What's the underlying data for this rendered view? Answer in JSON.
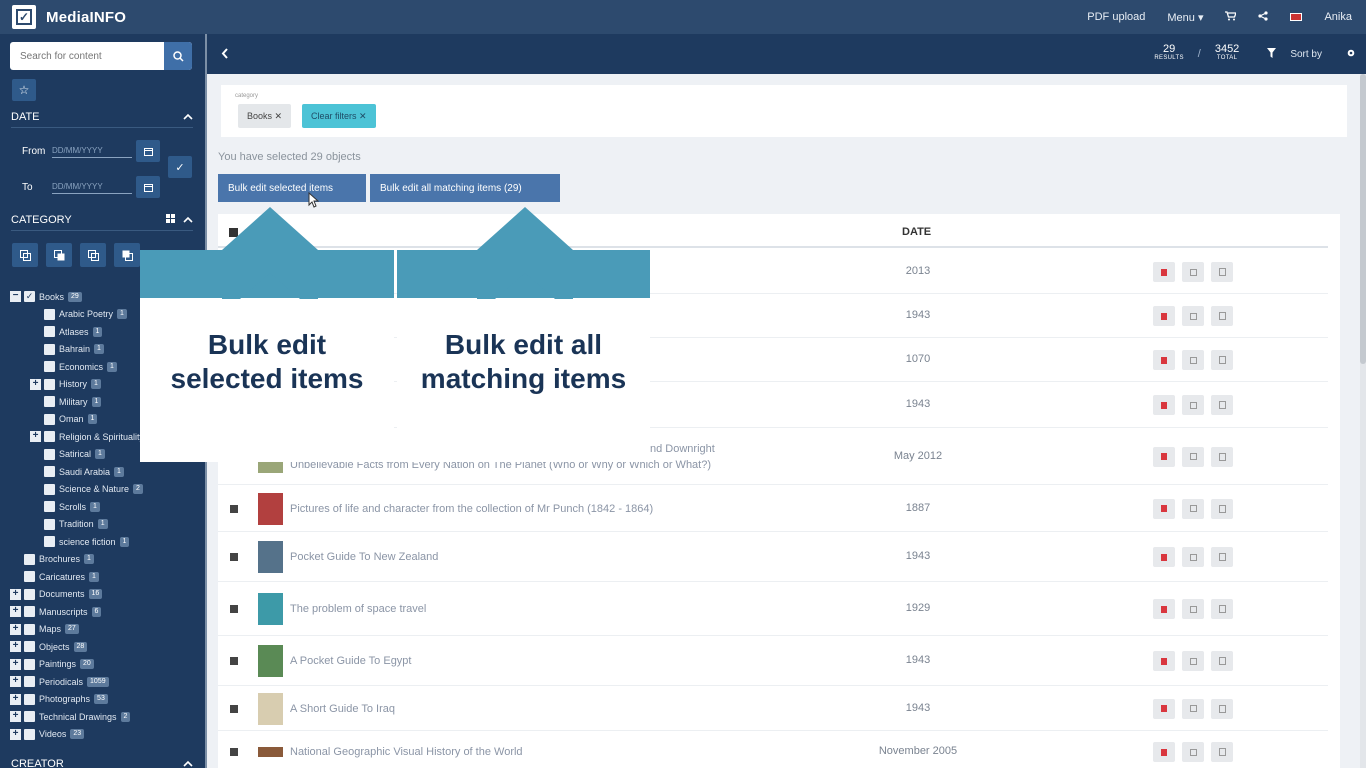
{
  "app": {
    "name": "MediaINFO"
  },
  "topnav": {
    "pdf_upload": "PDF upload",
    "menu": "Menu ▾",
    "cart_icon": "cart-icon",
    "share_icon": "share-icon",
    "user": "Anika"
  },
  "sidebar": {
    "search_placeholder": "Search for content",
    "date_section": "DATE",
    "from_label": "From",
    "to_label": "To",
    "date_placeholder": "DD/MM/YYYY",
    "category_section": "CATEGORY",
    "creator_section": "CREATOR",
    "tree": [
      {
        "label": "Books",
        "count": "29",
        "level": 0,
        "toggle": "−",
        "checked": true
      },
      {
        "label": "Arabic Poetry",
        "count": "1",
        "level": 1,
        "toggle": "",
        "checked": false
      },
      {
        "label": "Atlases",
        "count": "1",
        "level": 1,
        "toggle": "",
        "checked": false
      },
      {
        "label": "Bahrain",
        "count": "1",
        "level": 1,
        "toggle": "",
        "checked": false
      },
      {
        "label": "Economics",
        "count": "1",
        "level": 1,
        "toggle": "",
        "checked": false
      },
      {
        "label": "History",
        "count": "1",
        "level": 1,
        "toggle": "+",
        "checked": false
      },
      {
        "label": "Military",
        "count": "1",
        "level": 1,
        "toggle": "",
        "checked": false
      },
      {
        "label": "Oman",
        "count": "1",
        "level": 1,
        "toggle": "",
        "checked": false
      },
      {
        "label": "Religion & Spirituality",
        "count": "",
        "level": 1,
        "toggle": "+",
        "checked": false
      },
      {
        "label": "Satirical",
        "count": "1",
        "level": 1,
        "toggle": "",
        "checked": false
      },
      {
        "label": "Saudi Arabia",
        "count": "1",
        "level": 1,
        "toggle": "",
        "checked": false
      },
      {
        "label": "Science & Nature",
        "count": "2",
        "level": 1,
        "toggle": "",
        "checked": false
      },
      {
        "label": "Scrolls",
        "count": "1",
        "level": 1,
        "toggle": "",
        "checked": false
      },
      {
        "label": "Tradition",
        "count": "1",
        "level": 1,
        "toggle": "",
        "checked": false
      },
      {
        "label": "science fiction",
        "count": "1",
        "level": 1,
        "toggle": "",
        "checked": false
      },
      {
        "label": "Brochures",
        "count": "1",
        "level": 0,
        "toggle": "",
        "checked": false
      },
      {
        "label": "Caricatures",
        "count": "1",
        "level": 0,
        "toggle": "",
        "checked": false
      },
      {
        "label": "Documents",
        "count": "16",
        "level": 0,
        "toggle": "+",
        "checked": false
      },
      {
        "label": "Manuscripts",
        "count": "6",
        "level": 0,
        "toggle": "+",
        "checked": false
      },
      {
        "label": "Maps",
        "count": "27",
        "level": 0,
        "toggle": "+",
        "checked": false
      },
      {
        "label": "Objects",
        "count": "28",
        "level": 0,
        "toggle": "+",
        "checked": false
      },
      {
        "label": "Paintings",
        "count": "20",
        "level": 0,
        "toggle": "+",
        "checked": false
      },
      {
        "label": "Periodicals",
        "count": "1059",
        "level": 0,
        "toggle": "+",
        "checked": false
      },
      {
        "label": "Photographs",
        "count": "53",
        "level": 0,
        "toggle": "+",
        "checked": false
      },
      {
        "label": "Technical Drawings",
        "count": "2",
        "level": 0,
        "toggle": "+",
        "checked": false
      },
      {
        "label": "Videos",
        "count": "23",
        "level": 0,
        "toggle": "+",
        "checked": false
      }
    ]
  },
  "results": {
    "count": "29",
    "count_label": "RESULTS",
    "total": "3452",
    "total_label": "TOTAL",
    "sort_by": "Sort by"
  },
  "filters": {
    "label": "category",
    "books_chip": "Books ✕",
    "clear_chip": "Clear filters ✕"
  },
  "selection": {
    "text": "You have selected 29 objects",
    "bulk_selected": "Bulk edit selected items",
    "bulk_all": "Bulk edit all matching items (29)"
  },
  "table": {
    "date_header": "DATE",
    "rows": [
      {
        "title": "",
        "date": "2013",
        "thumb": ""
      },
      {
        "title": "",
        "date": "1943",
        "thumb": ""
      },
      {
        "title": "",
        "date": "1070",
        "thumb": ""
      },
      {
        "title": "",
        "date": "1943",
        "thumb": ""
      },
      {
        "title_line1": "nd Downright",
        "title_line2": "Unbelievable Facts from Every Nation on The Planet (Who or Why or Which or What?)",
        "date": "May 2012",
        "thumb": "#9aa678"
      },
      {
        "title": "Pictures of life and character from the collection of Mr Punch (1842 - 1864)",
        "date": "1887",
        "thumb": "#b2403f"
      },
      {
        "title": "Pocket Guide To New Zealand",
        "date": "1943",
        "thumb": "#55728a"
      },
      {
        "title": "The problem of space travel",
        "date": "1929",
        "thumb": "#3d9aa8"
      },
      {
        "title": "A Pocket Guide To Egypt",
        "date": "1943",
        "thumb": "#5a8a55"
      },
      {
        "title": "A Short Guide To Iraq",
        "date": "1943",
        "thumb": "#d8cdb0"
      },
      {
        "title": "National Geographic Visual History of the World",
        "date": "November 2005",
        "thumb": "#8a5a3a"
      }
    ]
  },
  "callouts": {
    "left_line1": "Bulk edit",
    "left_line2": "selected items",
    "right_line1": "Bulk edit all",
    "right_line2": "matching items"
  },
  "colors": {
    "header": "#2d4a6e",
    "sidebar": "#1e3a5f",
    "accent": "#4a75ab",
    "callout_band": "#4a9bb8"
  }
}
